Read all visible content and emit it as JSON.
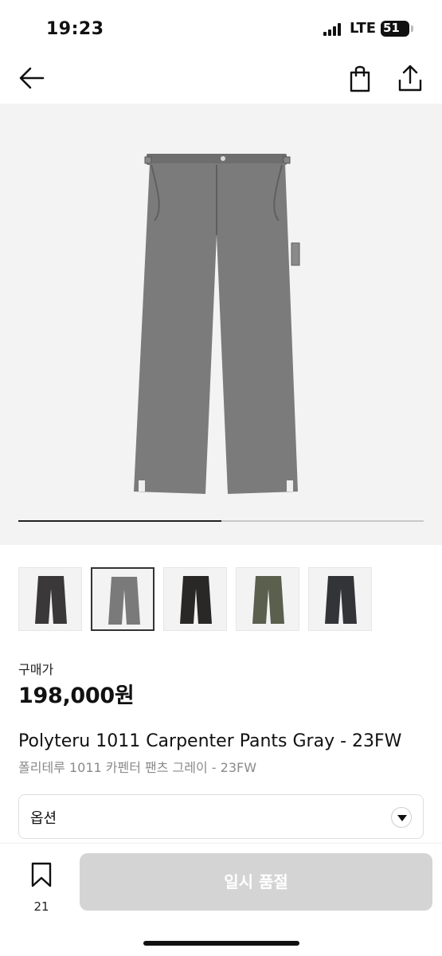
{
  "status_bar": {
    "time": "19:23",
    "network": "LTE",
    "battery": "51"
  },
  "nav": {
    "back_icon": "arrow-left-icon",
    "bag_icon": "shopping-bag-icon",
    "share_icon": "share-icon"
  },
  "gallery": {
    "progress": 0.5,
    "thumbnails": [
      {
        "color": "#3a3838"
      },
      {
        "color": "#7a7a7a"
      },
      {
        "color": "#2a2826"
      },
      {
        "color": "#5a5f4e"
      },
      {
        "color": "#333438"
      }
    ],
    "active_index": 1,
    "main_color": "#7b7b7b"
  },
  "price": {
    "label": "구매가",
    "value": "198,000원"
  },
  "product": {
    "name_en": "Polyteru 1011 Carpenter Pants Gray - 23FW",
    "name_ko": "폴리테루 1011 카펜터 팬츠 그레이 - 23FW"
  },
  "option": {
    "label": "옵션",
    "icon": "chevron-down-icon"
  },
  "bottom_bar": {
    "bookmark_icon": "bookmark-icon",
    "bookmark_count": "21",
    "action_label": "일시 품절"
  }
}
